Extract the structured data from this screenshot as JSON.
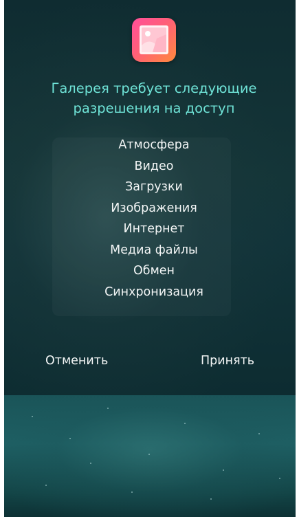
{
  "dialog": {
    "title": "Галерея требует следующие разрешения на доступ",
    "permissions": [
      "Атмосфера",
      "Видео",
      "Загрузки",
      "Изображения",
      "Интернет",
      "Медиа файлы",
      "Обмен",
      "Синхронизация"
    ],
    "cancel_label": "Отменить",
    "accept_label": "Принять"
  },
  "app_icon": {
    "icon": "gallery-icon",
    "colors": [
      "#ff4f9a",
      "#ff8a3c"
    ]
  },
  "colors": {
    "title": "#6fe3d7",
    "text": "#f2f5f5",
    "background": "#0f2c31"
  }
}
